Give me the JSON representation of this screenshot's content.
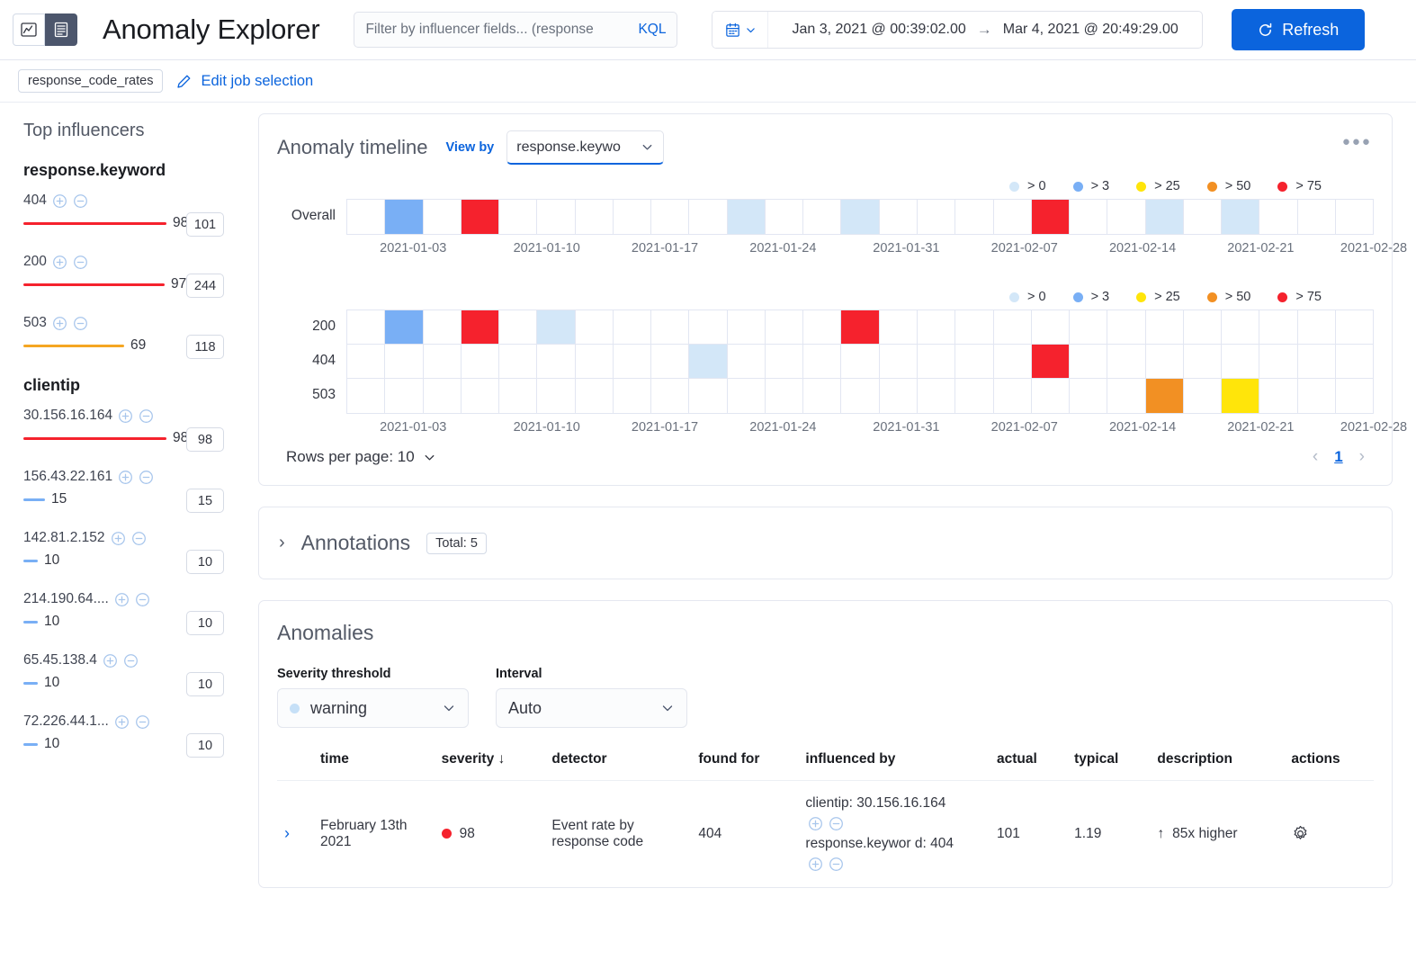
{
  "header": {
    "app_title": "Anomaly Explorer",
    "icons": {
      "chart": "line-chart-icon",
      "table": "table-icon"
    },
    "search": {
      "placeholder": "Filter by influencer fields... (response",
      "language_label": "KQL"
    },
    "date_range": {
      "start": "Jan 3, 2021 @ 00:39:02.00",
      "arrow": "→",
      "end": "Mar 4, 2021 @ 20:49:29.00"
    },
    "refresh_label": "Refresh"
  },
  "job_bar": {
    "job_chip": "response_code_rates",
    "edit_label": "Edit job selection"
  },
  "sidebar": {
    "title": "Top influencers",
    "groups": [
      {
        "name": "response.keyword",
        "items": [
          {
            "label": "404",
            "value": "98",
            "score": "101",
            "bar_color": "#f5222d",
            "bar_pct": 98
          },
          {
            "label": "200",
            "value": "97",
            "score": "244",
            "bar_color": "#f5222d",
            "bar_pct": 97
          },
          {
            "label": "503",
            "value": "69",
            "score": "118",
            "bar_color": "#f5a623",
            "bar_pct": 69
          }
        ]
      },
      {
        "name": "clientip",
        "items": [
          {
            "label": "30.156.16.164",
            "value": "98",
            "score": "98",
            "bar_color": "#f5222d",
            "bar_pct": 98
          },
          {
            "label": "156.43.22.161",
            "value": "15",
            "score": "15",
            "bar_color": "#79aff5",
            "bar_pct": 15
          },
          {
            "label": "142.81.2.152",
            "value": "10",
            "score": "10",
            "bar_color": "#79aff5",
            "bar_pct": 10
          },
          {
            "label": "214.190.64....",
            "value": "10",
            "score": "10",
            "bar_color": "#79aff5",
            "bar_pct": 10
          },
          {
            "label": "65.45.138.4",
            "value": "10",
            "score": "10",
            "bar_color": "#79aff5",
            "bar_pct": 10
          },
          {
            "label": "72.226.44.1...",
            "value": "10",
            "score": "10",
            "bar_color": "#79aff5",
            "bar_pct": 10
          }
        ]
      }
    ]
  },
  "timeline": {
    "title": "Anomaly timeline",
    "view_by_label": "View by",
    "view_by_value": "response.keywo",
    "rows_per_page_label": "Rows per page: 10",
    "page_number": "1",
    "prev_icon": "chevron-left-icon",
    "next_icon": "chevron-right-icon"
  },
  "chart_data": {
    "type": "heatmap",
    "title": "Anomaly timeline",
    "legend": [
      {
        "label": "> 0",
        "color": "#d3e7f8"
      },
      {
        "label": "> 3",
        "color": "#79aff5"
      },
      {
        "label": "> 25",
        "color": "#ffe50a"
      },
      {
        "label": "> 50",
        "color": "#f29023"
      },
      {
        "label": "> 75",
        "color": "#f5222d"
      }
    ],
    "legend_position": "top-right",
    "columns": 27,
    "xlabel": "",
    "ylabel": "",
    "tick_labels": [
      "2021-01-03",
      "2021-01-10",
      "2021-01-17",
      "2021-01-24",
      "2021-01-31",
      "2021-02-07",
      "2021-02-14",
      "2021-02-21",
      "2021-02-28"
    ],
    "tick_positions_pct": [
      6.5,
      19.5,
      31.0,
      42.5,
      54.5,
      66.0,
      77.5,
      89.0,
      100.0
    ],
    "lanes": [
      {
        "name": "Overall",
        "cells": [
          {
            "col": 1,
            "color": "#79aff5"
          },
          {
            "col": 3,
            "color": "#f5222d"
          },
          {
            "col": 10,
            "color": "#d3e7f8"
          },
          {
            "col": 13,
            "color": "#d3e7f8"
          },
          {
            "col": 18,
            "color": "#f5222d"
          },
          {
            "col": 21,
            "color": "#d3e7f8"
          },
          {
            "col": 23,
            "color": "#d3e7f8"
          }
        ]
      }
    ],
    "lanes_by_response": [
      {
        "name": "200",
        "cells": [
          {
            "col": 1,
            "color": "#79aff5"
          },
          {
            "col": 3,
            "color": "#f5222d"
          },
          {
            "col": 5,
            "color": "#d3e7f8"
          },
          {
            "col": 13,
            "color": "#f5222d"
          }
        ]
      },
      {
        "name": "404",
        "cells": [
          {
            "col": 9,
            "color": "#d3e7f8"
          },
          {
            "col": 18,
            "color": "#f5222d"
          }
        ]
      },
      {
        "name": "503",
        "cells": [
          {
            "col": 21,
            "color": "#f29023"
          },
          {
            "col": 23,
            "color": "#ffe50a"
          }
        ]
      }
    ]
  },
  "annotations": {
    "title": "Annotations",
    "badge": "Total: 5",
    "caret": "chevron-right-icon"
  },
  "anomalies": {
    "title": "Anomalies",
    "severity_label": "Severity threshold",
    "severity_value": "warning",
    "interval_label": "Interval",
    "interval_value": "Auto",
    "columns": [
      "time",
      "severity",
      "detector",
      "found for",
      "influenced by",
      "actual",
      "typical",
      "description",
      "actions"
    ],
    "sort_column": "severity",
    "sort_icon": "↓",
    "rows": [
      {
        "time": "February 13th 2021",
        "severity": "98",
        "severity_color": "#f5222d",
        "detector": "Event rate by response code",
        "found_for": "404",
        "influenced_by_1": "clientip: 30.156.16.164",
        "influenced_by_2": "response.keywor d: 404",
        "actual": "101",
        "typical": "1.19",
        "description": "85x higher",
        "description_arrow": "↑",
        "actions_icon": "gear-icon"
      }
    ]
  },
  "colors": {
    "accent": "#0b64dd",
    "border": "#e5e8f0",
    "text": "#343741"
  }
}
